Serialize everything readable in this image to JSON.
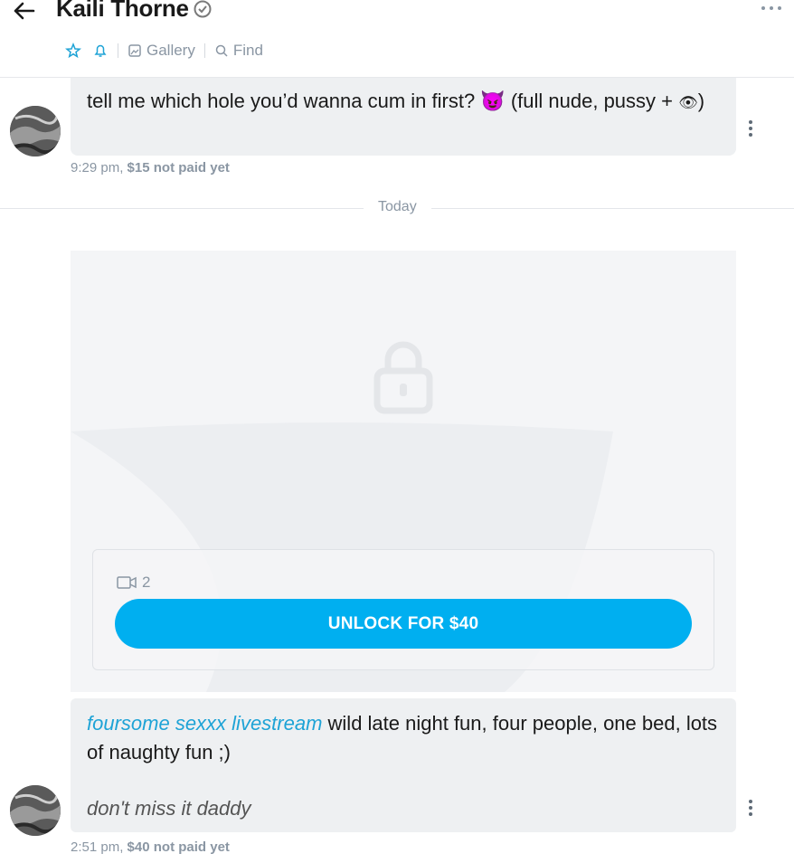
{
  "header": {
    "name": "Kaili Thorne",
    "toolbar": {
      "gallery_label": "Gallery",
      "find_label": "Find"
    }
  },
  "messages": [
    {
      "text_before": "tell me which hole you’d wanna cum in first? ",
      "emoji": "😈",
      "text_after": " (full nude, pussy + ",
      "eye_emoji": "👁",
      "text_end": ")",
      "time": "9:29 pm,",
      "price_status": "$15 not paid yet"
    }
  ],
  "divider": {
    "label": "Today"
  },
  "locked_media": {
    "video_count": "2",
    "unlock_label": "UNLOCK FOR $40"
  },
  "caption": {
    "link_text": "foursome sexxx livestream",
    "text": " wild late night fun, four people, one bed, lots of naughty fun ;)",
    "footer_text": "don't miss it daddy",
    "time": "2:51 pm,",
    "price_status": "$40 not paid yet"
  },
  "colors": {
    "accent": "#00aff0",
    "link": "#1ea3d6",
    "muted": "#8a96a3",
    "bubble": "#eef0f2"
  }
}
